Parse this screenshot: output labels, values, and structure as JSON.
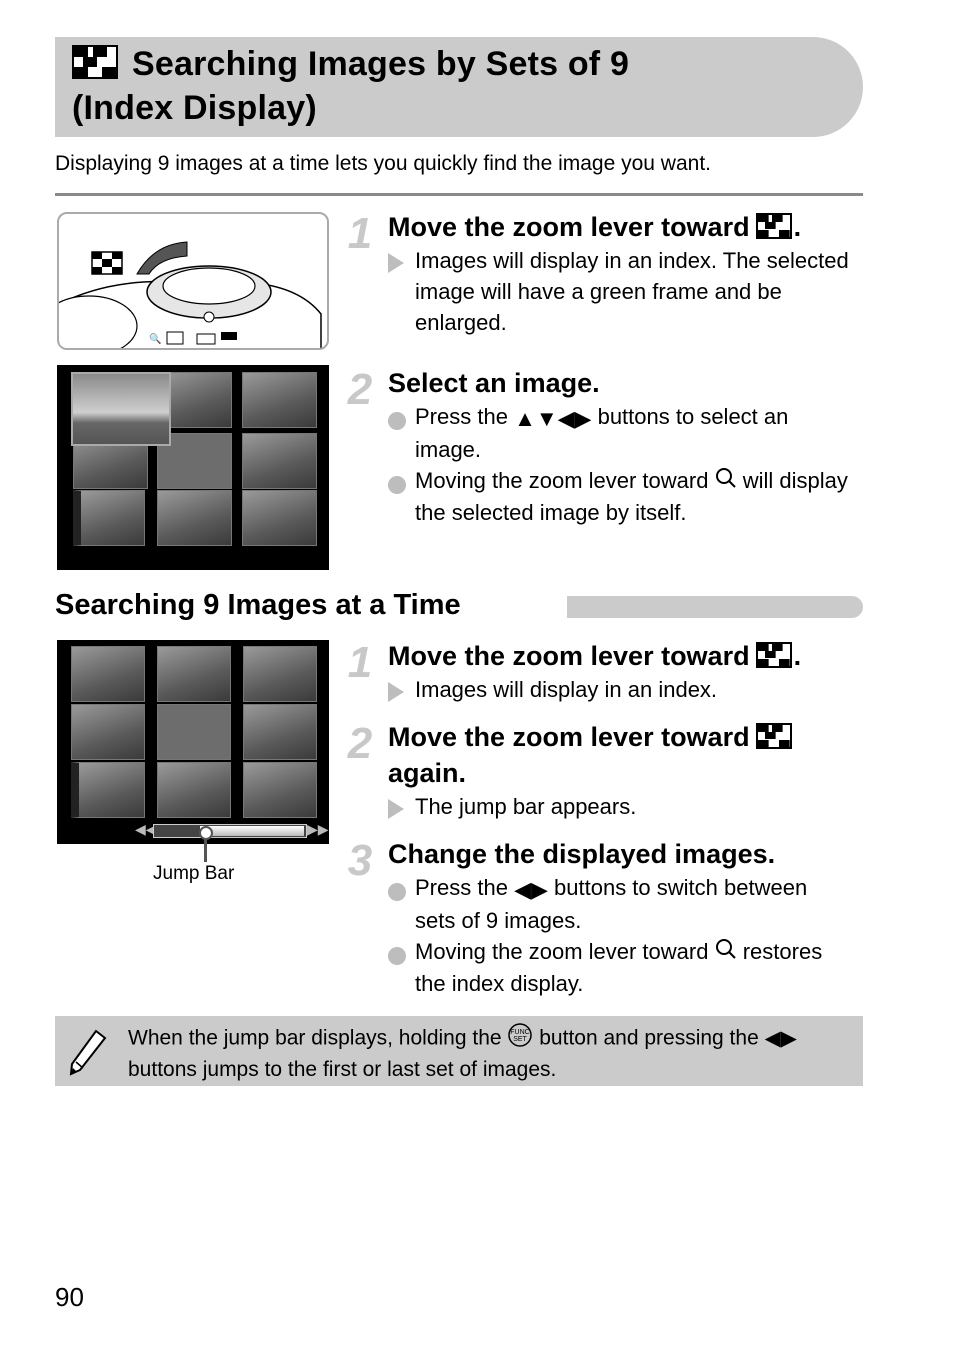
{
  "header": {
    "icon": "index-display-icon",
    "title_line1": "Searching Images by Sets of 9",
    "title_line2": "(Index Display)"
  },
  "intro": "Displaying 9 images at a time lets you quickly find the image you want.",
  "section1": {
    "steps": [
      {
        "number": "1",
        "heading": "Move the zoom lever toward",
        "heading_icon": "index-display-icon",
        "heading_suffix": ".",
        "items": [
          {
            "type": "result",
            "text": "Images will display in an index. The selected image will have a green frame and be enlarged."
          }
        ]
      },
      {
        "number": "2",
        "heading": "Select an image.",
        "items": [
          {
            "type": "bullet",
            "pre": "Press the",
            "icons": [
              "up-arrow-icon",
              "down-arrow-icon",
              "left-arrow-icon",
              "right-arrow-icon"
            ],
            "post": "buttons to select an image."
          },
          {
            "type": "bullet",
            "pre": "Moving the zoom lever toward",
            "icons": [
              "magnify-icon"
            ],
            "post": "will display the selected image by itself."
          }
        ]
      }
    ],
    "camera_labels": {
      "zoom_lever": "index-display-icon"
    }
  },
  "section2": {
    "heading": "Searching 9 Images at a Time",
    "jump_bar_label": "Jump Bar",
    "jump_bar_position": 0.3,
    "steps": [
      {
        "number": "1",
        "heading": "Move the zoom lever toward",
        "heading_icon": "index-display-icon",
        "heading_suffix": ".",
        "items": [
          {
            "type": "result",
            "text": "Images will display in an index."
          }
        ]
      },
      {
        "number": "2",
        "heading": "Move the zoom lever toward",
        "heading_icon": "index-display-icon",
        "heading_line2": "again.",
        "items": [
          {
            "type": "result",
            "text": "The jump bar appears."
          }
        ]
      },
      {
        "number": "3",
        "heading": "Change the displayed images.",
        "items": [
          {
            "type": "bullet",
            "pre": "Press the",
            "icons": [
              "left-arrow-icon",
              "right-arrow-icon"
            ],
            "post_line1": "buttons to switch between",
            "post_line2": "sets of 9 images."
          },
          {
            "type": "bullet",
            "pre": "Moving the zoom lever toward",
            "icons": [
              "magnify-icon"
            ],
            "post_line1": "restores",
            "post_line2": "the index display."
          }
        ]
      }
    ]
  },
  "note": {
    "icon": "pencil-icon",
    "line1_pre": "When the jump bar displays, holding the",
    "line1_icon": "func-set-button-icon",
    "line1_mid": "button and pressing the",
    "line2": "buttons jumps to the first or last set of images."
  },
  "page_number": "90"
}
